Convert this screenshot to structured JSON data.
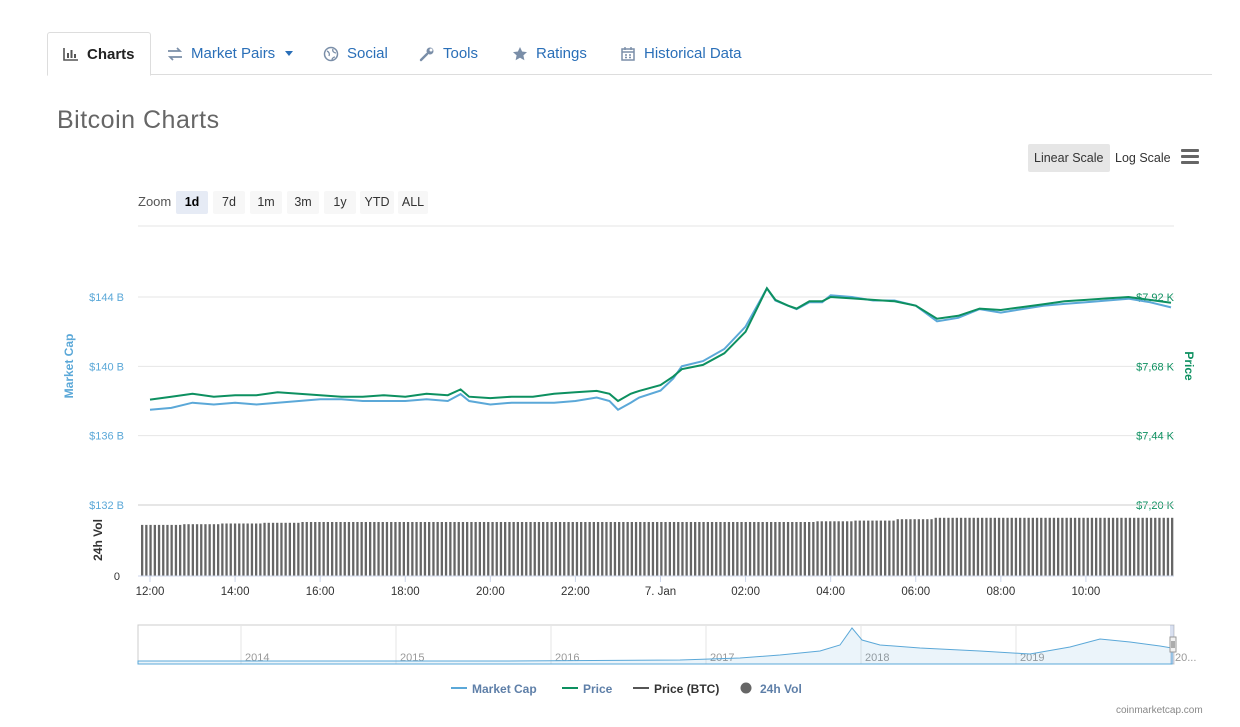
{
  "tabs": [
    {
      "label": "Charts",
      "icon": "bar-chart-icon",
      "active": true
    },
    {
      "label": "Market Pairs",
      "icon": "exchange-arrows-icon",
      "active": false,
      "dropdown": true
    },
    {
      "label": "Social",
      "icon": "globe-icon",
      "active": false
    },
    {
      "label": "Tools",
      "icon": "wrench-icon",
      "active": false
    },
    {
      "label": "Ratings",
      "icon": "star-icon",
      "active": false
    },
    {
      "label": "Historical Data",
      "icon": "calendar-icon",
      "active": false
    }
  ],
  "page_title": "Bitcoin Charts",
  "scale": {
    "linear": "Linear Scale",
    "log": "Log Scale",
    "selected": "linear"
  },
  "zoom": {
    "label": "Zoom",
    "options": [
      "1d",
      "7d",
      "1m",
      "3m",
      "1y",
      "YTD",
      "ALL"
    ],
    "selected": "1d"
  },
  "colors": {
    "market_cap": "#5ba8d8",
    "price": "#0d9060",
    "price_btc": "#555555",
    "volume": "#666666"
  },
  "watermark": "coinmarketcap.com",
  "chart_data": {
    "type": "line",
    "x_ticks": [
      "12:00",
      "14:00",
      "16:00",
      "18:00",
      "20:00",
      "22:00",
      "7. Jan",
      "02:00",
      "04:00",
      "06:00",
      "08:00",
      "10:00"
    ],
    "left_axis": {
      "title": "Market Cap",
      "ticks": [
        "$144 B",
        "$140 B",
        "$136 B",
        "$132 B"
      ],
      "range": [
        132,
        144
      ]
    },
    "right_axis": {
      "title": "Price",
      "ticks": [
        "$7,92 K",
        "$7,68 K",
        "$7,44 K",
        "$7,20 K"
      ],
      "range": [
        7.2,
        7.92
      ]
    },
    "volume_axis": {
      "title": "24h Vol",
      "ticks": [
        "0"
      ]
    },
    "grid": true,
    "x_hours": [
      0,
      0.5,
      1,
      1.5,
      2,
      2.5,
      3,
      3.5,
      4,
      4.5,
      5,
      5.5,
      6,
      6.5,
      7,
      7.3,
      7.5,
      8,
      8.5,
      9,
      9.5,
      10,
      10.5,
      10.8,
      11,
      11.3,
      11.5,
      12,
      12.3,
      12.5,
      13,
      13.5,
      14,
      14.5,
      14.7,
      15,
      15.2,
      15.5,
      15.8,
      16,
      16.5,
      17,
      17.5,
      18,
      18.5,
      19,
      19.5,
      20,
      20.5,
      21,
      21.5,
      22,
      22.5,
      23,
      23.5,
      24
    ],
    "series": [
      {
        "name": "Market Cap",
        "axis": "left",
        "values": [
          137.5,
          137.6,
          137.9,
          137.8,
          137.9,
          137.8,
          137.9,
          138.0,
          138.1,
          138.1,
          138.0,
          138.0,
          138.0,
          138.1,
          138.0,
          138.4,
          138.0,
          137.8,
          137.9,
          137.9,
          137.9,
          138.0,
          138.2,
          138.0,
          137.5,
          137.9,
          138.2,
          138.6,
          139.3,
          140.0,
          140.3,
          141.0,
          142.3,
          144.5,
          143.8,
          143.5,
          143.3,
          143.7,
          143.7,
          144.1,
          144.0,
          143.8,
          143.8,
          143.5,
          142.6,
          142.8,
          143.3,
          143.1,
          143.3,
          143.5,
          143.6,
          143.7,
          143.8,
          143.9,
          143.7,
          143.4
        ]
      },
      {
        "name": "Price",
        "axis": "right",
        "values": [
          7.565,
          7.575,
          7.585,
          7.575,
          7.58,
          7.58,
          7.59,
          7.585,
          7.58,
          7.575,
          7.575,
          7.58,
          7.575,
          7.585,
          7.58,
          7.6,
          7.575,
          7.57,
          7.575,
          7.575,
          7.585,
          7.59,
          7.595,
          7.585,
          7.56,
          7.585,
          7.595,
          7.615,
          7.645,
          7.67,
          7.685,
          7.725,
          7.8,
          7.95,
          7.91,
          7.89,
          7.88,
          7.905,
          7.905,
          7.92,
          7.915,
          7.91,
          7.905,
          7.89,
          7.845,
          7.855,
          7.88,
          7.875,
          7.885,
          7.895,
          7.905,
          7.91,
          7.915,
          7.92,
          7.91,
          7.9
        ]
      },
      {
        "name": "Price (BTC)",
        "axis": "none",
        "values": []
      },
      {
        "name": "24h Vol",
        "axis": "volume",
        "values": [
          0.72,
          0.73,
          0.74,
          0.75,
          0.76,
          0.76,
          0.76,
          0.76,
          0.76,
          0.76,
          0.76,
          0.76,
          0.76,
          0.76,
          0.76,
          0.76,
          0.76,
          0.77,
          0.78,
          0.8,
          0.82,
          0.82,
          0.82,
          0.82,
          0.82,
          0.82
        ]
      }
    ],
    "legend": {
      "placement": "bottom",
      "items": [
        "Market Cap",
        "Price",
        "Price (BTC)",
        "24h Vol"
      ]
    },
    "navigator": {
      "labels": [
        "2014",
        "2015",
        "2016",
        "2017",
        "2018",
        "2019",
        "20..."
      ]
    }
  }
}
